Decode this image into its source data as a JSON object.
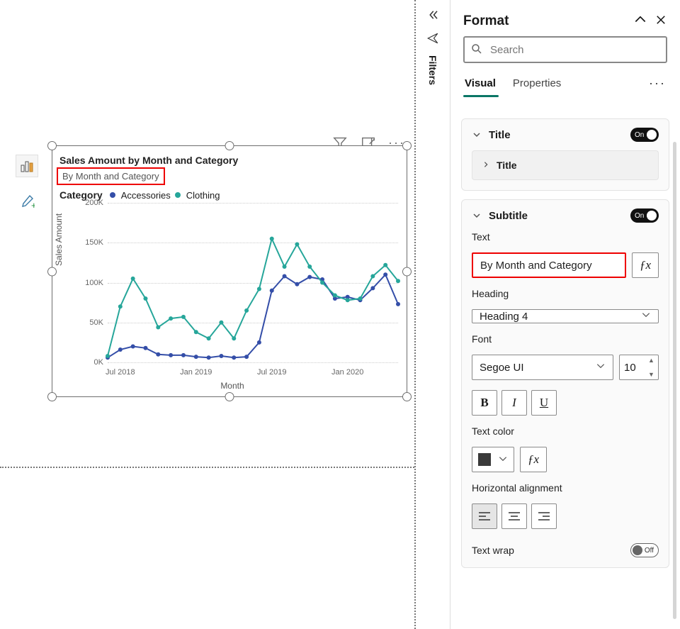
{
  "canvas": {
    "chart": {
      "title": "Sales Amount by Month and Category",
      "subtitle": "By Month and Category",
      "legend_label": "Category",
      "legend_items": [
        {
          "name": "Accessories",
          "color": "#344ea8"
        },
        {
          "name": "Clothing",
          "color": "#26a69a"
        }
      ],
      "y_axis_label": "Sales Amount",
      "x_axis_label": "Month"
    },
    "tools": {
      "filter_icon": "filter",
      "focus_icon": "focus-mode",
      "more_icon": "more-options"
    }
  },
  "filters_label": "Filters",
  "pane": {
    "title": "Format",
    "search_placeholder": "Search",
    "tabs": {
      "visual": "Visual",
      "properties": "Properties"
    },
    "title_section": {
      "label": "Title",
      "toggle": "On",
      "inner_label": "Title"
    },
    "subtitle": {
      "label": "Subtitle",
      "toggle": "On",
      "text_label": "Text",
      "text_value": "By Month and Category",
      "heading_label": "Heading",
      "heading_value": "Heading 4",
      "font_label": "Font",
      "font_value": "Segoe UI",
      "font_size": "10",
      "bold": "B",
      "italic": "I",
      "underline": "U",
      "text_color_label": "Text color",
      "halign_label": "Horizontal alignment",
      "text_wrap_label": "Text wrap",
      "text_wrap_toggle": "Off"
    }
  },
  "chart_data": {
    "type": "line",
    "title": "Sales Amount by Month and Category",
    "subtitle": "By Month and Category",
    "xlabel": "Month",
    "ylabel": "Sales Amount",
    "ylim": [
      0,
      200000
    ],
    "y_ticks": [
      "0K",
      "50K",
      "100K",
      "150K",
      "200K"
    ],
    "x_ticks": [
      "Jul 2018",
      "Jan 2019",
      "Jul 2019",
      "Jan 2020"
    ],
    "categories": [
      "2018-06",
      "2018-07",
      "2018-08",
      "2018-09",
      "2018-10",
      "2018-11",
      "2018-12",
      "2019-01",
      "2019-02",
      "2019-03",
      "2019-04",
      "2019-05",
      "2019-06",
      "2019-07",
      "2019-08",
      "2019-09",
      "2019-10",
      "2019-11",
      "2019-12",
      "2020-01",
      "2020-02",
      "2020-03",
      "2020-04",
      "2020-05"
    ],
    "series": [
      {
        "name": "Accessories",
        "color": "#344ea8",
        "values": [
          6000,
          16000,
          20000,
          18000,
          10000,
          9000,
          9000,
          7000,
          6000,
          8000,
          6000,
          7000,
          25000,
          90000,
          108000,
          98000,
          107000,
          104000,
          80000,
          82000,
          78000,
          93000,
          110000,
          73000
        ]
      },
      {
        "name": "Clothing",
        "color": "#26a69a",
        "values": [
          8000,
          70000,
          105000,
          80000,
          44000,
          55000,
          57000,
          38000,
          30000,
          50000,
          30000,
          65000,
          92000,
          155000,
          120000,
          148000,
          120000,
          100000,
          84000,
          78000,
          80000,
          108000,
          122000,
          102000
        ]
      }
    ]
  }
}
